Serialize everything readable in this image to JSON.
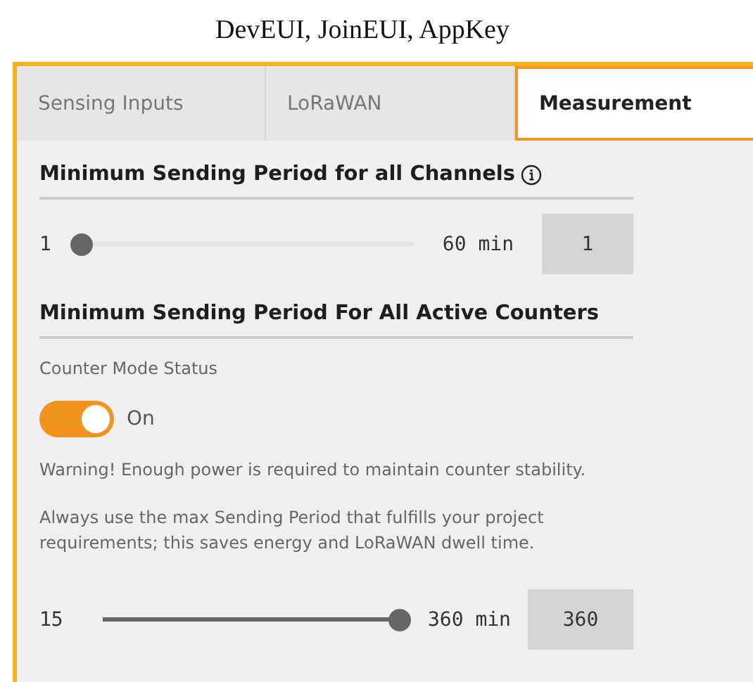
{
  "page_title": "DevEUI, JoinEUI, AppKey",
  "tabs": [
    {
      "label": "Sensing Inputs",
      "selected": false
    },
    {
      "label": "LoRaWAN",
      "selected": false
    },
    {
      "label": "Measurement",
      "selected": true
    }
  ],
  "channels_section": {
    "title": "Minimum Sending Period for all Channels",
    "slider": {
      "min_label": "1",
      "max_label": "60 min",
      "level": 0,
      "value": "1"
    }
  },
  "counters_section": {
    "title": "Minimum Sending Period For All Active Counters",
    "status_label": "Counter Mode Status",
    "toggle": {
      "on": true,
      "label": "On"
    },
    "warning": "Warning! Enough power is required to maintain counter stability.",
    "hint": "Always use the max Sending Period that fulfills your project requirements; this saves energy and LoRaWAN dwell time.",
    "slider": {
      "min_label": "15",
      "max_label": "360 min",
      "level": 1,
      "value": "360"
    }
  }
}
